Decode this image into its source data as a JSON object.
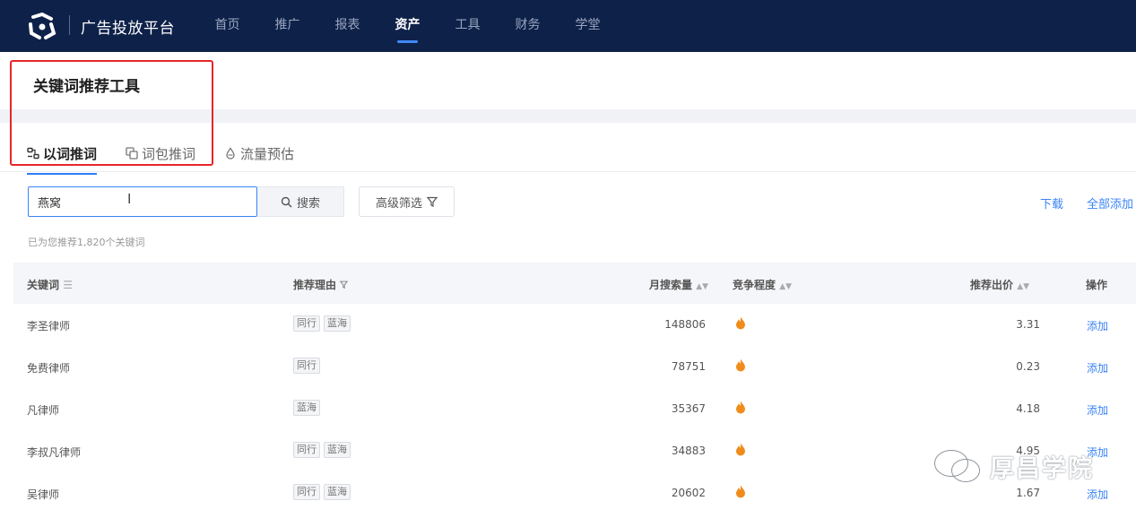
{
  "header": {
    "brand": "广告投放平台",
    "nav": [
      {
        "label": "首页",
        "active": false
      },
      {
        "label": "推广",
        "active": false
      },
      {
        "label": "报表",
        "active": false
      },
      {
        "label": "资产",
        "active": true
      },
      {
        "label": "工具",
        "active": false
      },
      {
        "label": "财务",
        "active": false
      },
      {
        "label": "学堂",
        "active": false
      }
    ]
  },
  "page": {
    "title": "关键词推荐工具"
  },
  "tabs": [
    {
      "label": "以词推词",
      "icon": "word-link-icon",
      "active": true
    },
    {
      "label": "词包推词",
      "icon": "copy-icon",
      "active": false
    },
    {
      "label": "流量预估",
      "icon": "drop-icon",
      "active": false
    }
  ],
  "search": {
    "value": "燕窝",
    "button_label": "搜索",
    "filter_label": "高级筛选",
    "download_label": "下载",
    "add_all_label": "全部添加",
    "hint": "已为您推荐1,820个关键词"
  },
  "table": {
    "columns": {
      "keyword": "关键词",
      "reason": "推荐理由",
      "monthly_search": "月搜索量",
      "competition": "竞争程度",
      "bid": "推荐出价",
      "action": "操作"
    },
    "rows": [
      {
        "keyword": "李圣律师",
        "tags": [
          "同行",
          "蓝海"
        ],
        "monthly_search": "148806",
        "bid": "3.31",
        "action": "添加"
      },
      {
        "keyword": "免费律师",
        "tags": [
          "同行"
        ],
        "monthly_search": "78751",
        "bid": "0.23",
        "action": "添加"
      },
      {
        "keyword": "凡律师",
        "tags": [
          "蓝海"
        ],
        "monthly_search": "35367",
        "bid": "4.18",
        "action": "添加"
      },
      {
        "keyword": "李叔凡律师",
        "tags": [
          "同行",
          "蓝海"
        ],
        "monthly_search": "34883",
        "bid": "4.95",
        "action": "添加"
      },
      {
        "keyword": "吴律师",
        "tags": [
          "同行",
          "蓝海"
        ],
        "monthly_search": "20602",
        "bid": "1.67",
        "action": "添加"
      }
    ]
  },
  "watermark": "厚昌学院",
  "colors": {
    "header_bg": "#0e2149",
    "accent": "#3a83f5",
    "flame": "#f08c1c",
    "highlight_border": "#e7262a"
  }
}
